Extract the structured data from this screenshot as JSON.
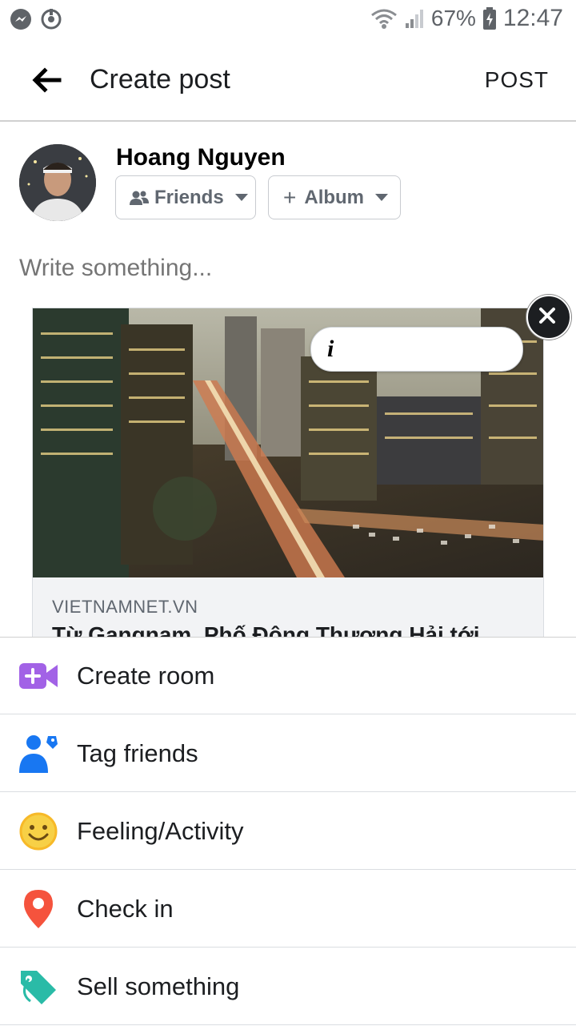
{
  "status_bar": {
    "battery": "67%",
    "time": "12:47"
  },
  "header": {
    "title": "Create post",
    "post_label": "POST"
  },
  "user": {
    "name": "Hoang Nguyen"
  },
  "audience": {
    "friends_label": "Friends",
    "album_label": "Album"
  },
  "composer": {
    "placeholder": "Write something..."
  },
  "link_preview": {
    "domain": "VIETNAMNET.VN",
    "title": "Từ Gangnam, Phố Đông Thượng Hải tới"
  },
  "options": [
    {
      "label": "Create room",
      "icon": "video-plus-icon",
      "color": "#a262e6"
    },
    {
      "label": "Tag friends",
      "icon": "tag-person-icon",
      "color": "#1877f2"
    },
    {
      "label": "Feeling/Activity",
      "icon": "smiley-icon",
      "color": "#f7b928"
    },
    {
      "label": "Check in",
      "icon": "location-pin-icon",
      "color": "#f5533d"
    },
    {
      "label": "Sell something",
      "icon": "price-tag-icon",
      "color": "#2abba7"
    }
  ]
}
